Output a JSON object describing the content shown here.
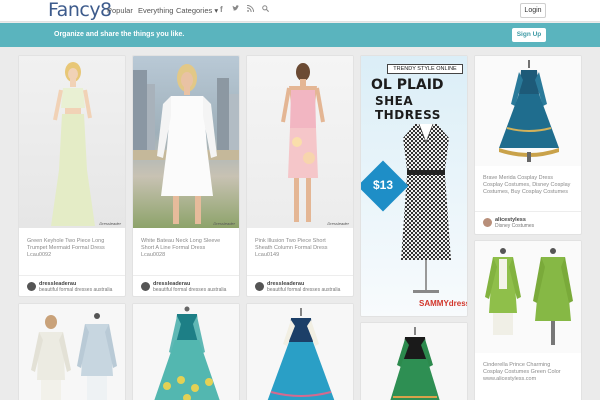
{
  "nav": {
    "logo": "Fancy8",
    "popular": "Popular",
    "everything": "Everything",
    "categories": "Categories ▾",
    "login": "Login"
  },
  "icons": {
    "facebook": "facebook-icon",
    "twitter": "twitter-icon",
    "rss": "rss-icon",
    "search": "search-icon"
  },
  "banner": {
    "text": "Organize and share the things you like.",
    "signup": "Sign Up"
  },
  "cards": [
    {
      "title_lines": [
        "Green Keyhole Two Piece Long",
        "Trumpet Mermaid Formal Dress",
        "Lcau0092"
      ],
      "user": "dressleaderau",
      "board": "beautiful formal dresses australia",
      "watermark": "Dressleader"
    },
    {
      "title_lines": [
        "White Bateau Neck Long Sleeve",
        "Short A Line Formal Dress",
        "Lcau0028"
      ],
      "user": "dressleaderau",
      "board": "beautiful formal dresses australia",
      "watermark": "Dressleader"
    },
    {
      "title_lines": [
        "Pink Illusion Two Piece Short",
        "Sheath Column Formal Dress",
        "Lcau0149"
      ],
      "user": "dressleaderau",
      "board": "beautiful formal dresses australia",
      "watermark": "Dressleader"
    },
    {
      "ad_line1": "TRENDY STYLE ONLINE",
      "ad_line2": "OL PLAID",
      "ad_line3": "SHEA THDRESS",
      "price": "$13",
      "brand": "SAMMYdress"
    },
    {
      "title_lines": [
        "Brave Merida Cosplay Dress",
        "Cosplay Costumes, Disney Cosplay",
        "Costumes, Buy Cosplay Costumes"
      ],
      "user": "alicestyless",
      "board": "Disney Costumes"
    },
    {
      "title_lines": [
        "Cinderella Prince Charming",
        "Cosplay Costumes Green Color",
        "www.alicestyless.com"
      ]
    }
  ]
}
